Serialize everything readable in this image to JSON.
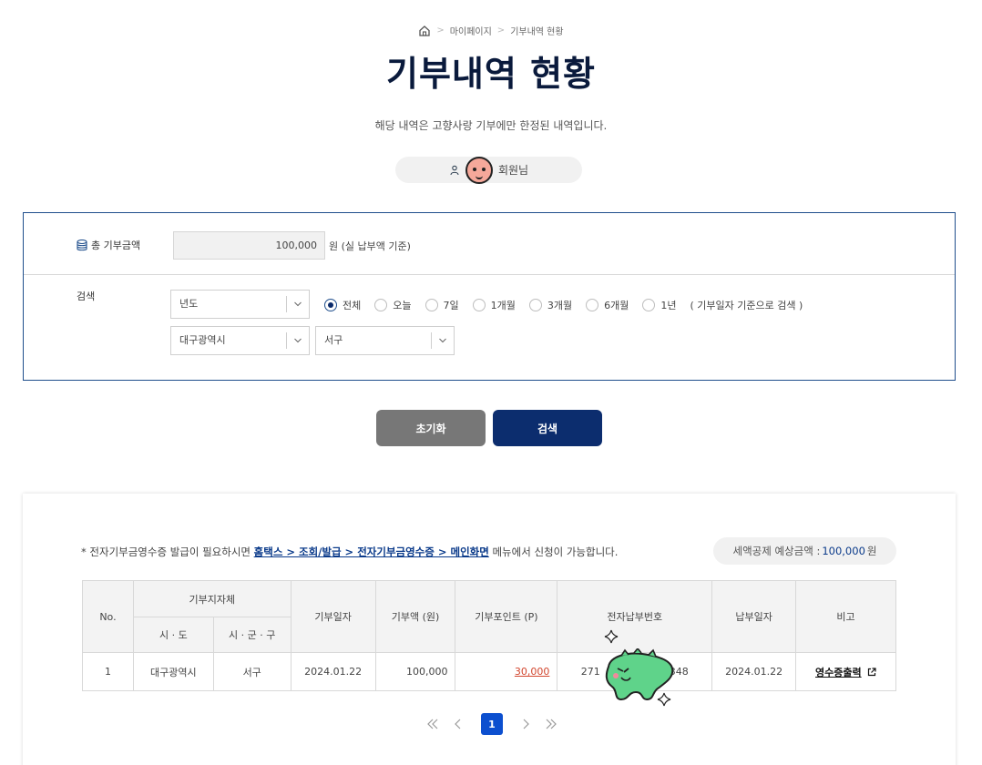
{
  "breadcrumb": {
    "home": "home-icon",
    "items": [
      "마이페이지",
      "기부내역 현황"
    ],
    "separator": ">"
  },
  "page": {
    "title": "기부내역 현황",
    "subtitle": "해당 내역은 고향사랑 기부에만 한정된 내역입니다.",
    "member_suffix": "회원님"
  },
  "search_panel": {
    "total_label": "총 기부금액",
    "total_value": "100,000",
    "total_unit": "원  (실 납부액 기준)",
    "search_label": "검색",
    "year_select": "년도",
    "sido_select": "대구광역시",
    "sigungu_select": "서구",
    "periods": [
      {
        "label": "전체",
        "checked": true
      },
      {
        "label": "오늘",
        "checked": false
      },
      {
        "label": "7일",
        "checked": false
      },
      {
        "label": "1개월",
        "checked": false
      },
      {
        "label": "3개월",
        "checked": false
      },
      {
        "label": "6개월",
        "checked": false
      },
      {
        "label": "1년",
        "checked": false
      }
    ],
    "period_note": "( 기부일자 기준으로 검색 )"
  },
  "buttons": {
    "reset": "초기화",
    "search": "검색"
  },
  "results": {
    "notice_prefix": "* 전자기부금영수증 발급이 필요하시면 ",
    "notice_link": "홈택스 > 조회/발급 > 전자기부금영수증 > 메인화면",
    "notice_suffix": " 메뉴에서 신청이 가능합니다.",
    "estimate_label": "세액공제 예상금액 : ",
    "estimate_amount": "100,000",
    "estimate_unit": " 원",
    "headers": {
      "no": "No.",
      "org": "기부지자체",
      "sido": "시 · 도",
      "sigungu": "시 · 군 · 구",
      "date": "기부일자",
      "amount": "기부액 (원)",
      "point": "기부포인트 (P)",
      "epay": "전자납부번호",
      "paydate": "납부일자",
      "note": "비고"
    },
    "rows": [
      {
        "no": "1",
        "sido": "대구광역시",
        "sigungu": "서구",
        "date": "2024.01.22",
        "amount": "100,000",
        "point": "30,000",
        "epay_start": "271",
        "epay_end": "348",
        "paydate": "2024.01.22",
        "note": "영수증출력"
      }
    ]
  },
  "pagination": {
    "current": "1"
  },
  "colors": {
    "navy": "#0c2d6e",
    "accent_blue": "#0c4fcf",
    "point_red": "#d2462e",
    "reset_gray": "#777777"
  }
}
